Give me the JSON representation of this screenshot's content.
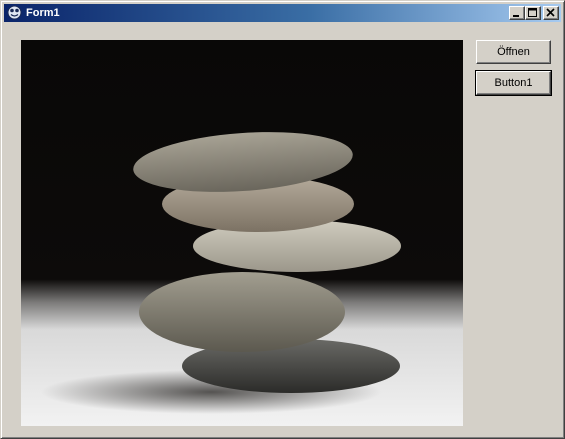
{
  "window": {
    "title": "Form1",
    "controls": {
      "minimize_icon": "minimize-icon",
      "maximize_icon": "maximize-icon",
      "close_icon": "close-icon"
    }
  },
  "picture": {
    "icon": "stacked-stones-image"
  },
  "buttons": {
    "open_label": "Öffnen",
    "button1_label": "Button1"
  },
  "colors": {
    "titlebar_start": "#0a246a",
    "titlebar_end": "#a6caf0",
    "face": "#d4d0c8"
  }
}
